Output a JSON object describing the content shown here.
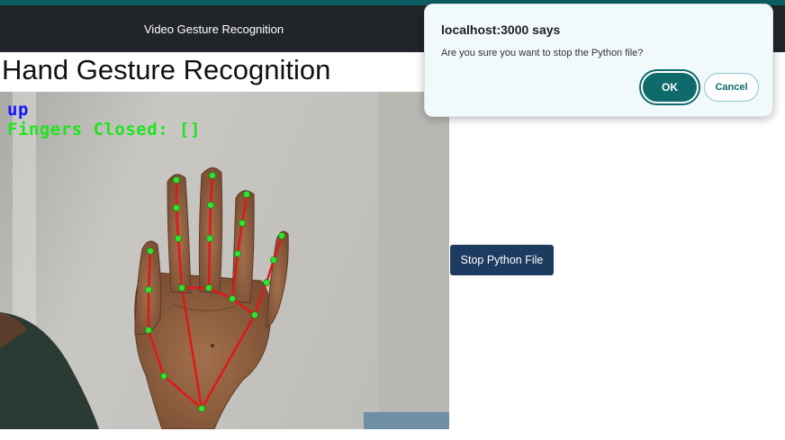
{
  "navbar": {
    "link_label": "Video Gesture Recognition"
  },
  "page": {
    "title": "Hand Gesture Recognition"
  },
  "video": {
    "direction_text": "up",
    "fingers_closed_text": "Fingers Closed: []",
    "direction_color": "#1515ff",
    "fingers_color": "#1ee61e",
    "landmark_color": "#2ee62e",
    "connection_color": "#e01818"
  },
  "controls": {
    "stop_label": "Stop Python File"
  },
  "dialog": {
    "title": "localhost:3000 says",
    "message": "Are you sure you want to stop the Python file?",
    "ok_label": "OK",
    "cancel_label": "Cancel"
  }
}
